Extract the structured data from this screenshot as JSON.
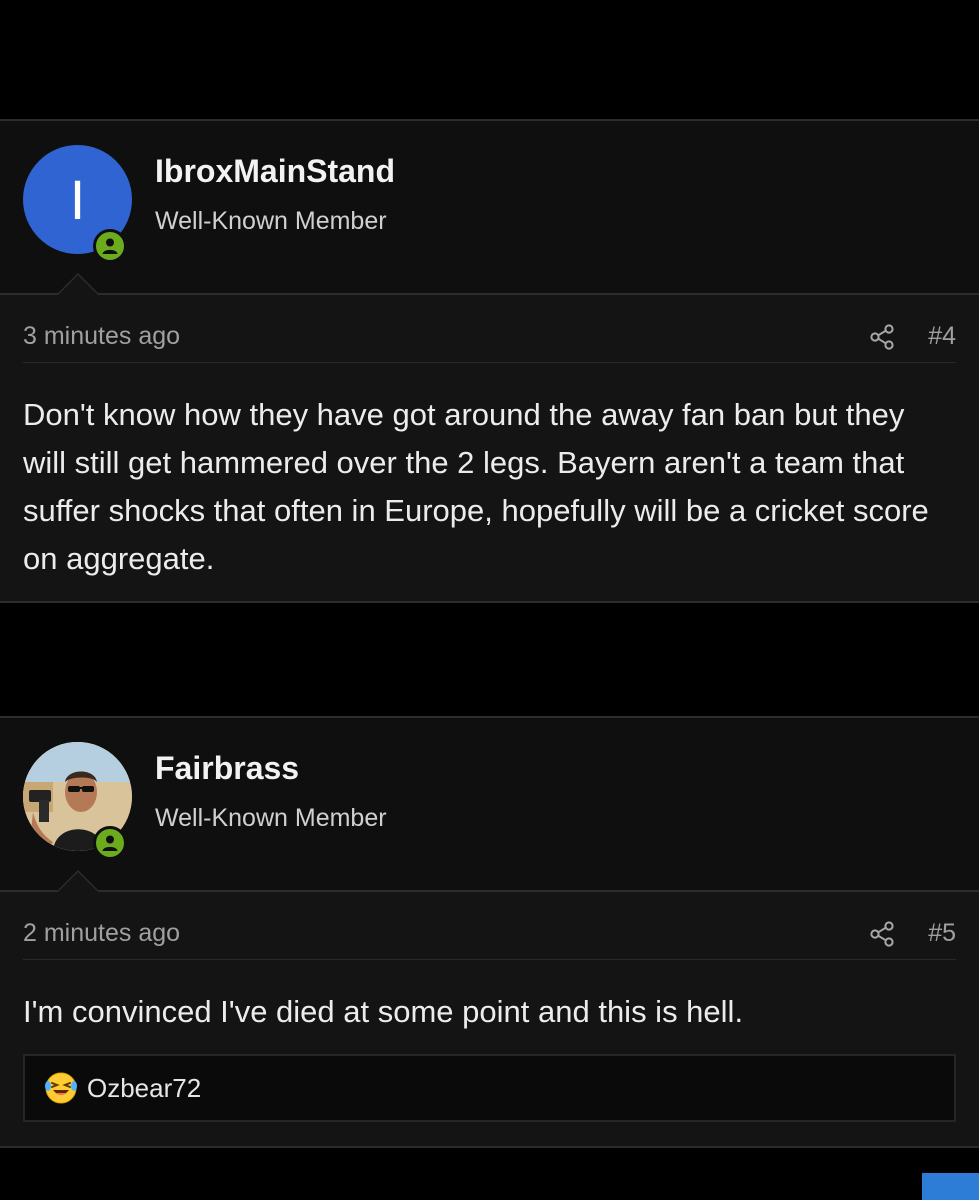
{
  "posts": [
    {
      "username": "IbroxMainStand",
      "user_title": "Well-Known Member",
      "avatar_letter": "I",
      "avatar_color": "#2f64d2",
      "online": true,
      "timestamp": "3 minutes ago",
      "post_number": "#4",
      "message": "Don't know how they have got around the away fan ban but they will still get hammered over the 2 legs. Bayern aren't a team that suffer shocks that often in Europe, hopefully will be a cricket score on aggregate."
    },
    {
      "username": "Fairbrass",
      "user_title": "Well-Known Member",
      "avatar_type": "photo",
      "online": true,
      "timestamp": "2 minutes ago",
      "post_number": "#5",
      "message": "I'm convinced I've died at some point and this is hell.",
      "reactions": {
        "emoji": "laughing-crying-emoji",
        "users": "Ozbear72"
      }
    }
  ],
  "colors": {
    "background": "#000000",
    "post_background": "#141414",
    "online_badge": "#6dab1e",
    "accent": "#2d7cd6"
  }
}
